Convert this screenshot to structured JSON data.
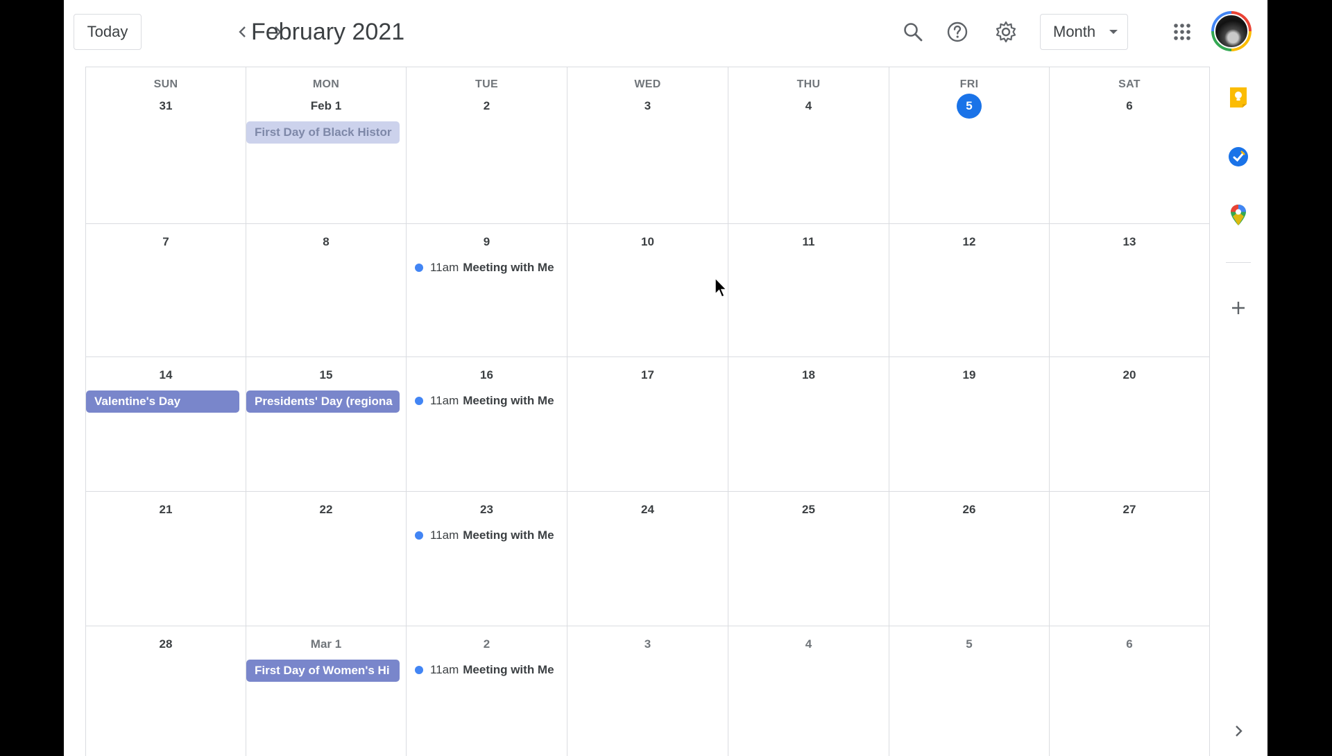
{
  "header": {
    "today_label": "Today",
    "title": "February 2021",
    "view_label": "Month",
    "icons": [
      "chevron-left-icon",
      "chevron-right-icon",
      "search-icon",
      "help-icon",
      "gear-icon",
      "apps-grid-icon"
    ]
  },
  "weekdays": [
    "SUN",
    "MON",
    "TUE",
    "WED",
    "THU",
    "FRI",
    "SAT"
  ],
  "weeks": [
    [
      {
        "date": "31"
      },
      {
        "date": "Feb 1",
        "chips": [
          {
            "label": "First Day of Black Histor",
            "style": "faded"
          }
        ]
      },
      {
        "date": "2"
      },
      {
        "date": "3"
      },
      {
        "date": "4"
      },
      {
        "date": "5",
        "today": true
      },
      {
        "date": "6"
      }
    ],
    [
      {
        "date": "7"
      },
      {
        "date": "8"
      },
      {
        "date": "9",
        "events": [
          {
            "time": "11am",
            "title": "Meeting with Me"
          }
        ]
      },
      {
        "date": "10"
      },
      {
        "date": "11"
      },
      {
        "date": "12"
      },
      {
        "date": "13"
      }
    ],
    [
      {
        "date": "14",
        "chips": [
          {
            "label": "Valentine's Day",
            "style": "holiday"
          }
        ]
      },
      {
        "date": "15",
        "chips": [
          {
            "label": "Presidents' Day (regiona",
            "style": "holiday"
          }
        ]
      },
      {
        "date": "16",
        "events": [
          {
            "time": "11am",
            "title": "Meeting with Me"
          }
        ]
      },
      {
        "date": "17"
      },
      {
        "date": "18"
      },
      {
        "date": "19"
      },
      {
        "date": "20"
      }
    ],
    [
      {
        "date": "21"
      },
      {
        "date": "22"
      },
      {
        "date": "23",
        "events": [
          {
            "time": "11am",
            "title": "Meeting with Me"
          }
        ]
      },
      {
        "date": "24"
      },
      {
        "date": "25"
      },
      {
        "date": "26"
      },
      {
        "date": "27"
      }
    ],
    [
      {
        "date": "28"
      },
      {
        "date": "Mar 1",
        "other": true,
        "chips": [
          {
            "label": "First Day of Women's Hi",
            "style": "holiday"
          }
        ]
      },
      {
        "date": "2",
        "other": true,
        "events": [
          {
            "time": "11am",
            "title": "Meeting with Me"
          }
        ]
      },
      {
        "date": "3",
        "other": true
      },
      {
        "date": "4",
        "other": true
      },
      {
        "date": "5",
        "other": true
      },
      {
        "date": "6",
        "other": true
      }
    ]
  ],
  "side_panel": {
    "icons": [
      "keep-icon",
      "tasks-icon",
      "maps-icon",
      "add-icon",
      "chevron-right-icon"
    ]
  },
  "colors": {
    "accent": "#1a73e8",
    "holiday_chip": "#7986cb",
    "holiday_chip_faded": "#ccd2ec",
    "event_dot": "#4285f4",
    "grid_line": "#dadce0"
  }
}
